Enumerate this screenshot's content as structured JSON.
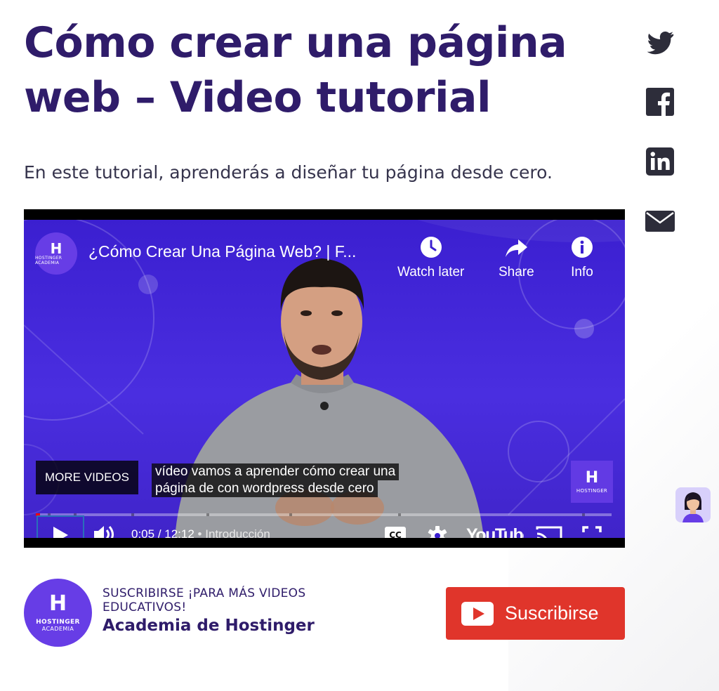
{
  "article": {
    "title": "Cómo crear una página web – Video tutorial",
    "subtitle": "En este tutorial, aprenderás a diseñar tu página desde cero."
  },
  "share": {
    "items": [
      {
        "name": "twitter",
        "icon": "twitter-icon"
      },
      {
        "name": "facebook",
        "icon": "facebook-icon"
      },
      {
        "name": "linkedin",
        "icon": "linkedin-icon"
      },
      {
        "name": "email",
        "icon": "envelope-icon"
      }
    ]
  },
  "video": {
    "channel_logo": {
      "mark": "H",
      "text": "HOSTINGER ACADEMIA"
    },
    "title": "¿Cómo Crear Una Página Web? | F...",
    "actions": {
      "watch_later": "Watch later",
      "share": "Share",
      "info": "Info"
    },
    "more_videos": "MORE VIDEOS",
    "caption_line1": "vídeo vamos a aprender cómo crear una",
    "caption_line2": "página de con wordpress desde cero",
    "watermark": {
      "mark": "H",
      "text": "HOSTINGER"
    },
    "time_current": "0:05",
    "time_separator": " / ",
    "time_total": "12:12",
    "chapter_separator": " • ",
    "chapter": "Introducción",
    "youtube_logo": "YouTube",
    "played_fraction": 0.007,
    "accent_color": "#ff0000"
  },
  "subscribe": {
    "avatar": {
      "mark": "H",
      "line1": "HOSTINGER",
      "line2": "ACADEMIA"
    },
    "cta": "SUSCRIBIRSE ¡PARA MÁS VIDEOS EDUCATIVOS!",
    "channel_name": "Academia de Hostinger",
    "button_label": "Suscribirse",
    "button_color": "#e0352b"
  },
  "colors": {
    "brand_dark": "#2f1c6a",
    "brand_purple": "#673de6"
  }
}
